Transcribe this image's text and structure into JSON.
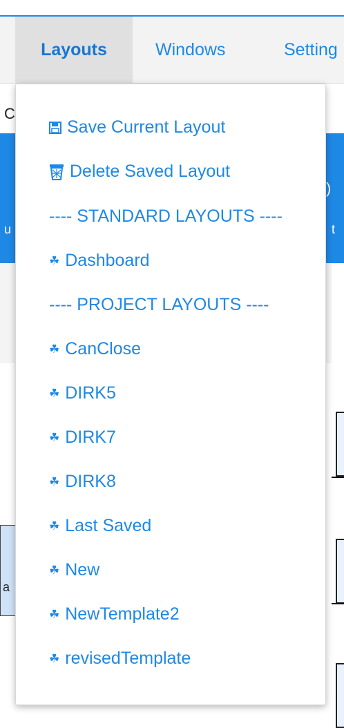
{
  "menubar": {
    "tabs": [
      {
        "label": "Layouts"
      },
      {
        "label": "Windows"
      },
      {
        "label": "Setting"
      }
    ]
  },
  "dropdown": {
    "save_label": "Save Current Layout",
    "delete_label": "Delete Saved Layout",
    "standard_header": "---- STANDARD LAYOUTS ----",
    "standard_items": [
      "Dashboard"
    ],
    "project_header": "---- PROJECT LAYOUTS ----",
    "project_items": [
      "CanClose",
      "DIRK5",
      "DIRK7",
      "DIRK8",
      "Last Saved",
      "New",
      "NewTemplate2",
      "revisedTemplate"
    ]
  },
  "colors": {
    "accent": "#1e88e5",
    "menubar_bg": "#f3f3f3",
    "active_tab_bg": "#e0e0e0"
  },
  "icons": {
    "save": "floppy-disk-icon",
    "delete": "trash-icon",
    "layout": "sitemap-icon"
  }
}
